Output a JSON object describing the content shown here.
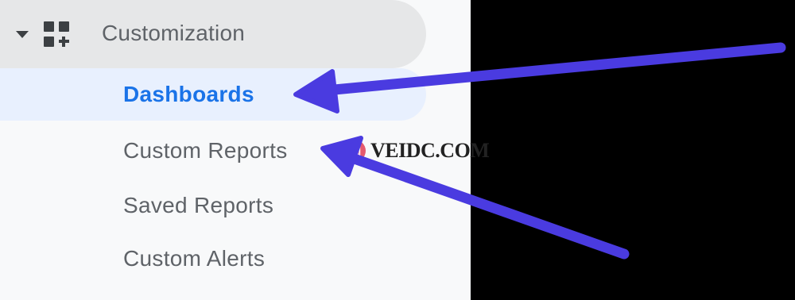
{
  "section": {
    "title": "Customization",
    "caret_icon": "caret-down-icon",
    "icon": "dashboard-add-icon"
  },
  "nav_items": [
    {
      "label": "Dashboards",
      "active": true
    },
    {
      "label": "Custom Reports",
      "active": false
    },
    {
      "label": "Saved Reports",
      "active": false
    },
    {
      "label": "Custom Alerts",
      "active": false
    }
  ],
  "watermark": {
    "badge": "测",
    "text": "VEIDC.COM"
  },
  "colors": {
    "active_text": "#1a73e8",
    "active_bg": "#e8f0fe",
    "arrow": "#4a3be0",
    "watermark_badge": "#e55a6e"
  }
}
